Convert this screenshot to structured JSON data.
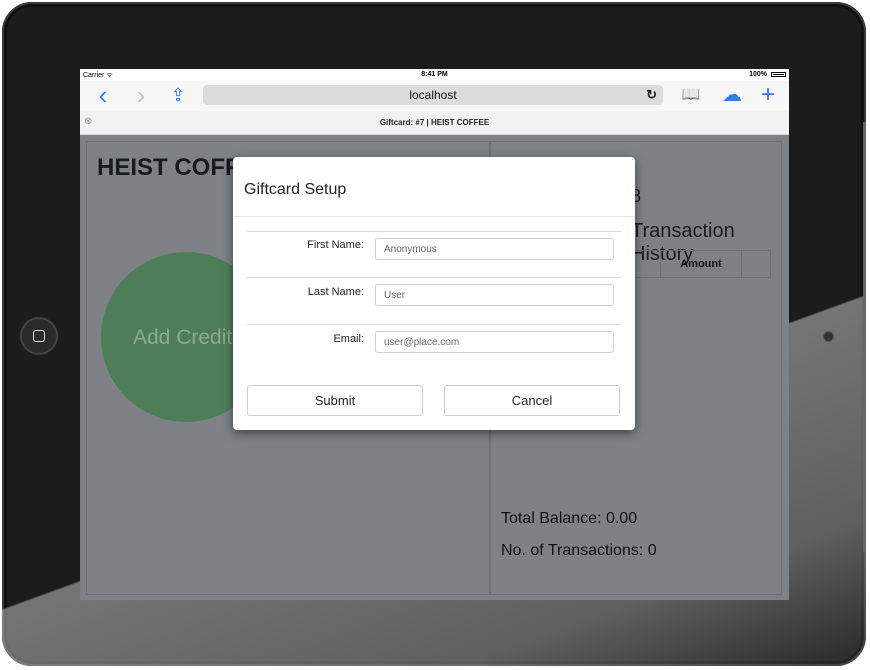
{
  "status_bar": {
    "carrier": "Carrier ᯤ",
    "time": "8:41 PM",
    "battery": "100%"
  },
  "browser": {
    "back_icon": "‹",
    "forward_icon": "›",
    "share_icon": "⇪",
    "address": "localhost",
    "reload_icon": "↻",
    "bookmarks_icon": "📖",
    "cloud_icon": "☁",
    "new_tab_icon": "+",
    "tab_close_icon": "⊗",
    "tab_title": "Giftcard: #7 | HEIST COFFEE"
  },
  "page": {
    "store_name": "HEIST COFFEE",
    "add_credit_label": "Add Credit",
    "small_digit": "8",
    "history_title": "Transaction History",
    "amount_header": "Amount",
    "total_balance": "Total Balance: 0.00",
    "transaction_count": "No. of Transactions: 0"
  },
  "modal": {
    "title": "Giftcard Setup",
    "fields": [
      {
        "label": "First Name:",
        "value": "Anonymous"
      },
      {
        "label": "Last Name:",
        "value": "User"
      },
      {
        "label": "Email:",
        "value": "user@place.com"
      }
    ],
    "submit_label": "Submit",
    "cancel_label": "Cancel"
  }
}
